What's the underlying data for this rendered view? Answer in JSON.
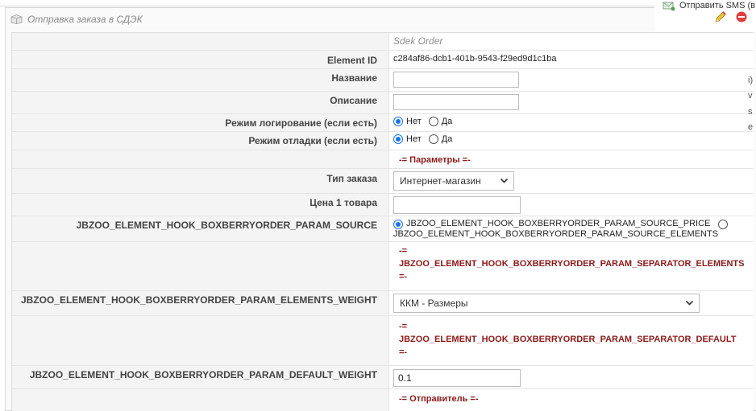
{
  "panel": {
    "title": "Отправка заказа в СДЭК"
  },
  "actions": {
    "sms_label": "Отправить SMS (в",
    "side_fragments": [
      "i)",
      "v",
      "s",
      "e"
    ]
  },
  "form": {
    "subtitle": "Sdek Order",
    "element_id": {
      "label": "Element ID",
      "value": "c284af86-dcb1-401b-9543-f29ed9d1c1ba"
    },
    "name": {
      "label": "Название",
      "value": ""
    },
    "description": {
      "label": "Описание",
      "value": ""
    },
    "log_mode": {
      "label": "Режим логирование (если есть)",
      "options": [
        "Нет",
        "Да"
      ],
      "selected": "Нет"
    },
    "debug_mode": {
      "label": "Режим отладки (если есть)",
      "options": [
        "Нет",
        "Да"
      ],
      "selected": "Нет"
    },
    "params_section": "-= Параметры =-",
    "order_type": {
      "label": "Тип заказа",
      "value": "Интернет-магазин"
    },
    "price": {
      "label": "Цена 1 товара",
      "value": ""
    },
    "param_source": {
      "label": "JBZOO_ELEMENT_HOOK_BOXBERRYORDER_PARAM_SOURCE",
      "option_price": "JBZOO_ELEMENT_HOOK_BOXBERRYORDER_PARAM_SOURCE_PRICE",
      "option_elements": "JBZOO_ELEMENT_HOOK_BOXBERRYORDER_PARAM_SOURCE_ELEMENTS",
      "selected": "JBZOO_ELEMENT_HOOK_BOXBERRYORDER_PARAM_SOURCE_PRICE"
    },
    "separator_elements": {
      "open": "-=",
      "text": "JBZOO_ELEMENT_HOOK_BOXBERRYORDER_PARAM_SEPARATOR_ELEMENTS",
      "close": "=-"
    },
    "elements_weight": {
      "label": "JBZOO_ELEMENT_HOOK_BOXBERRYORDER_PARAM_ELEMENTS_WEIGHT",
      "value": "ККМ - Размеры"
    },
    "separator_default": {
      "open": "-=",
      "text": "JBZOO_ELEMENT_HOOK_BOXBERRYORDER_PARAM_SEPARATOR_DEFAULT",
      "close": "=-"
    },
    "default_weight": {
      "label": "JBZOO_ELEMENT_HOOK_BOXBERRYORDER_PARAM_DEFAULT_WEIGHT",
      "value": "0.1"
    },
    "sender_section": "-= Отправитель =-"
  },
  "colors": {
    "accent_radio": "#1a73e8",
    "separator_text": "#8b1a1a",
    "label_bg": "#f4f4f4"
  }
}
